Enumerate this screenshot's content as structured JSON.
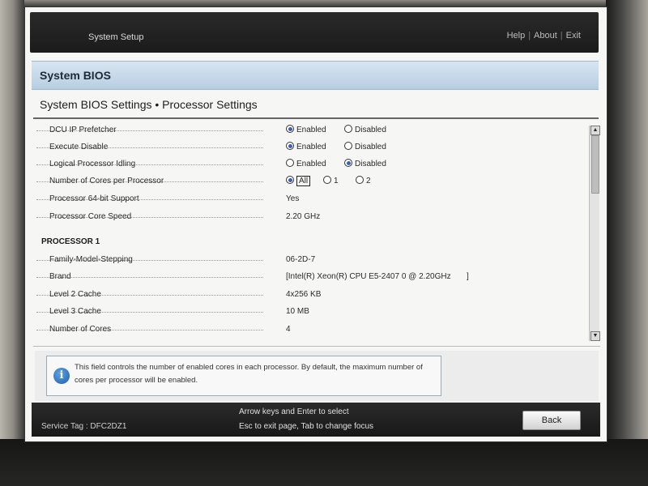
{
  "header": {
    "app_title": "System Setup",
    "links": [
      "Help",
      "About",
      "Exit"
    ]
  },
  "section": {
    "title": "System BIOS"
  },
  "page": {
    "title": "System BIOS Settings • Processor Settings"
  },
  "settings": {
    "dcu_ip": {
      "label": "DCU IP Prefetcher",
      "options": [
        "Enabled",
        "Disabled"
      ],
      "selected": "Enabled"
    },
    "execute_disable": {
      "label": "Execute Disable",
      "options": [
        "Enabled",
        "Disabled"
      ],
      "selected": "Enabled"
    },
    "logical_idling": {
      "label": "Logical Processor Idling",
      "options": [
        "Enabled",
        "Disabled"
      ],
      "selected": "Disabled"
    },
    "cores_per_proc": {
      "label": "Number of Cores per Processor",
      "options": [
        "All",
        "1",
        "2"
      ],
      "selected": "All"
    },
    "proc_64bit": {
      "label": "Processor 64-bit Support",
      "value": "Yes"
    },
    "core_speed": {
      "label": "Processor Core Speed",
      "value": "2.20 GHz"
    }
  },
  "processor1": {
    "heading": "PROCESSOR 1",
    "family": {
      "label": "Family-Model-Stepping",
      "value": "06-2D-7"
    },
    "brand": {
      "label": "Brand",
      "value": "[Intel(R) Xeon(R) CPU E5-2407 0 @ 2.20GHz       ]"
    },
    "l2": {
      "label": "Level 2 Cache",
      "value": "4x256 KB"
    },
    "l3": {
      "label": "Level 3 Cache",
      "value": "10 MB"
    },
    "cores": {
      "label": "Number of Cores",
      "value": "4"
    }
  },
  "help": {
    "icon": "info-icon",
    "text": "This field controls the number of enabled cores in each processor. By default, the maximum number of cores per processor will be enabled."
  },
  "footer": {
    "service_tag": "Service Tag : DFC2DZ1",
    "hint_line1": "Arrow keys and Enter to select",
    "hint_line2": "Esc to exit page, Tab to change focus",
    "back_label": "Back"
  },
  "colors": {
    "section_bar": "#b7cee2",
    "radio_selected": "#3b5fb5",
    "dark_bar": "#1b1b1b"
  }
}
